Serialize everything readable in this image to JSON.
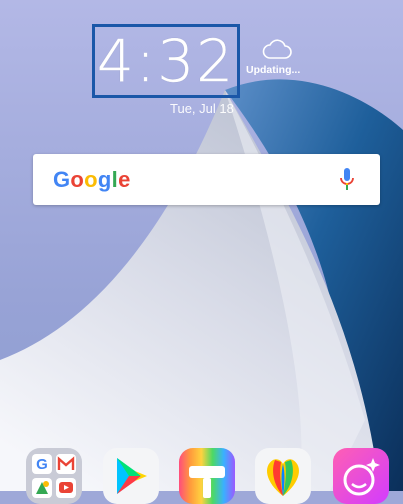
{
  "clock": {
    "time": "4:32",
    "date": "Tue, Jul 18"
  },
  "weather": {
    "icon": "cloud-icon",
    "status": "Updating..."
  },
  "search": {
    "logo_letters": [
      {
        "ch": "G",
        "color": "#4285F4"
      },
      {
        "ch": "o",
        "color": "#EA4335"
      },
      {
        "ch": "o",
        "color": "#FBBC05"
      },
      {
        "ch": "g",
        "color": "#4285F4"
      },
      {
        "ch": "l",
        "color": "#34A853"
      },
      {
        "ch": "e",
        "color": "#EA4335"
      }
    ],
    "mic_icon": "microphone-icon"
  },
  "dock": {
    "apps": [
      {
        "icon": "google-apps-folder-icon"
      },
      {
        "icon": "play-store-icon"
      },
      {
        "icon": "theme-roller-icon"
      },
      {
        "icon": "photo-gallery-icon"
      },
      {
        "icon": "selfie-camera-icon"
      }
    ]
  },
  "colors": {
    "highlight": "#1a57a8",
    "wallpaper": "#9ea8d8"
  }
}
